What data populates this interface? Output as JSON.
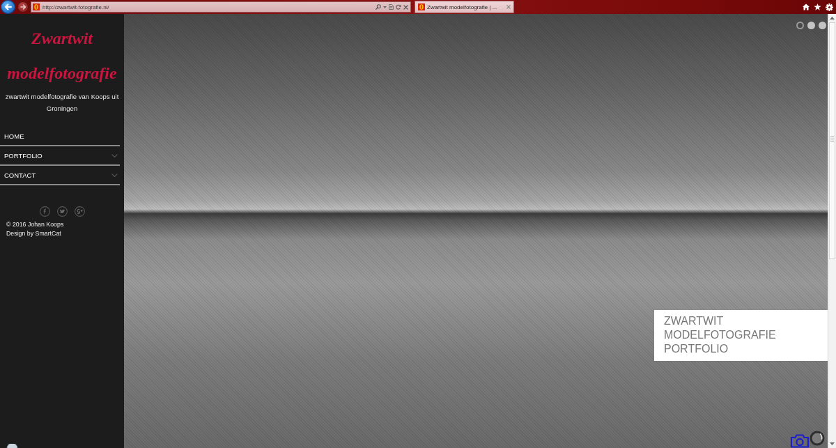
{
  "browser": {
    "url": "http://zwartwit-fotografie.nl/",
    "tabs": [
      {
        "title": "Zwartwit modelfotografie | ...",
        "selected": true
      }
    ]
  },
  "sidebar": {
    "site_title": "Zwartwit modelfotografie",
    "tagline": "zwartwit modelfotografie van Koops uit Groningen",
    "menu": [
      {
        "label": "HOME",
        "has_submenu": false
      },
      {
        "label": "PORTFOLIO",
        "has_submenu": true
      },
      {
        "label": "CONTACT",
        "has_submenu": true
      }
    ],
    "copyright": "© 2016 Johan Koops",
    "credit": "Design by SmartCat"
  },
  "slider": {
    "slides": [
      {
        "selected": true
      },
      {
        "selected": false
      },
      {
        "selected": false
      }
    ],
    "caption": "ZWARTWIT MODELFOTOGRAFIE PORTFOLIO"
  }
}
